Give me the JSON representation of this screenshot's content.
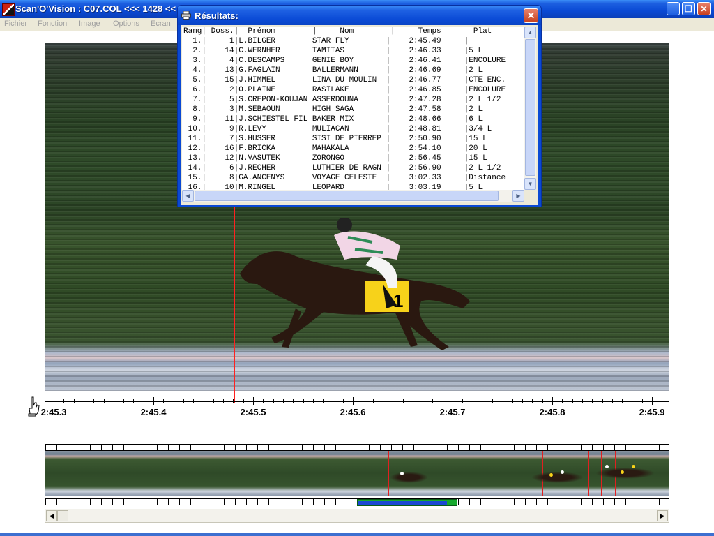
{
  "window": {
    "title": "Scan'O'Vision :  C07.COL <<< 1428 <<",
    "minimize": "_",
    "maximize": "❐",
    "close": "✕"
  },
  "menu": [
    {
      "label": "Fichier"
    },
    {
      "label": "Fonction"
    },
    {
      "label": "Image"
    },
    {
      "label": "Options"
    },
    {
      "label": "Ecran"
    }
  ],
  "ruler": {
    "labels": [
      "2:45.3",
      "2:45.4",
      "2:45.5",
      "2:45.6",
      "2:45.7",
      "2:45.8",
      "2:45.9"
    ]
  },
  "saddle_number": "1",
  "results": {
    "title": "Résultats:",
    "close": "✕",
    "header": "Rang| Doss.|  Prénom        |     Nom        |     Temps      |Plat",
    "rows": [
      "  1.|     1|L.BILGER       |STAR FLY        |    2:45.49     |",
      "  2.|    14|C.WERNHER      |TAMITAS         |    2:46.33     |5 L",
      "  3.|     4|C.DESCAMPS     |GENIE BOY       |    2:46.41     |ENCOLURE",
      "  4.|    13|G.FAGLAIN      |BALLERMANN      |    2:46.69     |2 L",
      "  5.|    15|J.HIMMEL       |LINA DU MOULIN  |    2:46.77     |CTE ENC.",
      "  6.|     2|O.PLAINE       |RASILAKE        |    2:46.85     |ENCOLURE",
      "  7.|     5|S.CREPON-KOUJAN|ASSERDOUNA      |    2:47.28     |2 L 1/2",
      "  8.|     3|M.SEBAOUN      |HIGH SAGA       |    2:47.58     |2 L",
      "  9.|    11|J.SCHIESTEL FIL|BAKER MIX       |    2:48.66     |6 L",
      " 10.|     9|R.LEVY         |MULIACAN        |    2:48.81     |3/4 L",
      " 11.|     7|S.HUSSER       |SISI DE PIERREP |    2:50.90     |15 L",
      " 12.|    16|F.BRICKA       |MAHAKALA        |    2:54.10     |20 L",
      " 13.|    12|N.VASUTEK      |ZORONGO         |    2:56.45     |15 L",
      " 14.|     6|J.RECHER       |LUTHIER DE RAGN |    2:56.90     |2 L 1/2",
      " 15.|     8|GA.ANCENYS     |VOYAGE CELESTE  |    3:02.33     |Distance",
      " 16.|    10|M.RINGEL       |LEOPARD         |    3:03.19     |5 L"
    ]
  },
  "colors": {
    "timing_line": "#ff2020",
    "saddle_cloth": "#f7d21a",
    "overview_selection": "#16a92e",
    "title_bar": "#0a49d4"
  },
  "icons": {
    "app": "app-icon",
    "hand": "hand-pointer-icon",
    "printer": "printer-icon"
  }
}
